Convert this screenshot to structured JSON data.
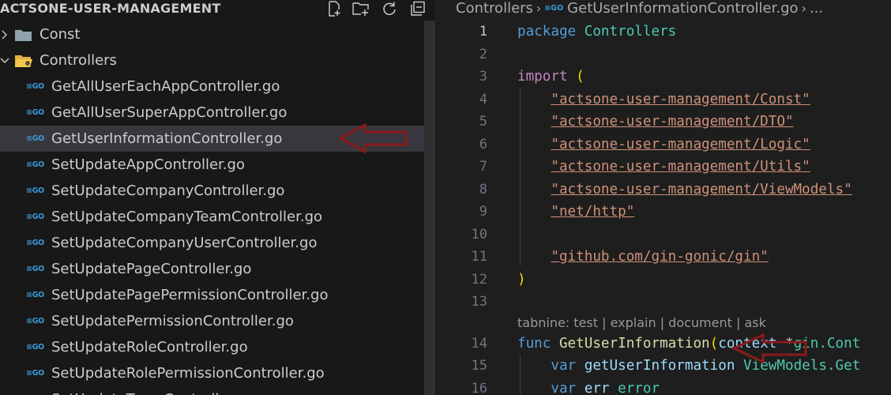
{
  "explorer": {
    "title": "ACTSONE-USER-MANAGEMENT",
    "actions": [
      "new-file-icon",
      "new-folder-icon",
      "refresh-icon",
      "collapse-all-icon"
    ],
    "folders": [
      {
        "label": "Const",
        "expanded": false
      },
      {
        "label": "Controllers",
        "expanded": true
      }
    ],
    "file_icon_text": "≡GO",
    "files": [
      "GetAllUserEachAppController.go",
      "GetAllUserSuperAppController.go",
      "GetUserInformationController.go",
      "SetUpdateAppController.go",
      "SetUpdateCompanyController.go",
      "SetUpdateCompanyTeamController.go",
      "SetUpdateCompanyUserController.go",
      "SetUpdatePageController.go",
      "SetUpdatePagePermissionController.go",
      "SetUpdatePermissionController.go",
      "SetUpdateRoleController.go",
      "SetUpdateRolePermissionController.go",
      "SetUpdateTeamController.go"
    ],
    "selected_file": "GetUserInformationController.go"
  },
  "editor": {
    "breadcrumb": {
      "folder": "Controllers",
      "file": "GetUserInformationController.go",
      "more": "..."
    },
    "line_numbers": [
      "1",
      "2",
      "3",
      "4",
      "5",
      "6",
      "7",
      "8",
      "9",
      "10",
      "11",
      "12",
      "13",
      "14",
      "15",
      "16"
    ],
    "active_line": "1",
    "code": {
      "l1_kw": "package",
      "l1_name": "Controllers",
      "l3_kw": "import",
      "l3_paren": "(",
      "imports": [
        "\"actsone-user-management/Const\"",
        "\"actsone-user-management/DTO\"",
        "\"actsone-user-management/Logic\"",
        "\"actsone-user-management/Utils\"",
        "\"actsone-user-management/ViewModels\"",
        "\"net/http\"",
        "\"github.com/gin-gonic/gin\""
      ],
      "l12_paren": ")",
      "l14_kw": "func",
      "l14_fn": "GetUserInformation",
      "l14_open": "(",
      "l14_param": "context",
      "l14_type_pre": " *",
      "l14_type_pkg": "gin",
      "l14_type_rest": ".Cont",
      "l15_kw": "var",
      "l15_var": "getUserInformation",
      "l15_pkg": "ViewModels",
      "l15_rest": ".Get",
      "l16_kw": "var",
      "l16_var": "err",
      "l16_type": "error"
    },
    "codelens": {
      "prefix": "tabnine: ",
      "actions": [
        "test",
        "explain",
        "document",
        "ask"
      ],
      "separator": " | "
    }
  },
  "annotations": {
    "arrow_color": "#8b1a1a"
  }
}
